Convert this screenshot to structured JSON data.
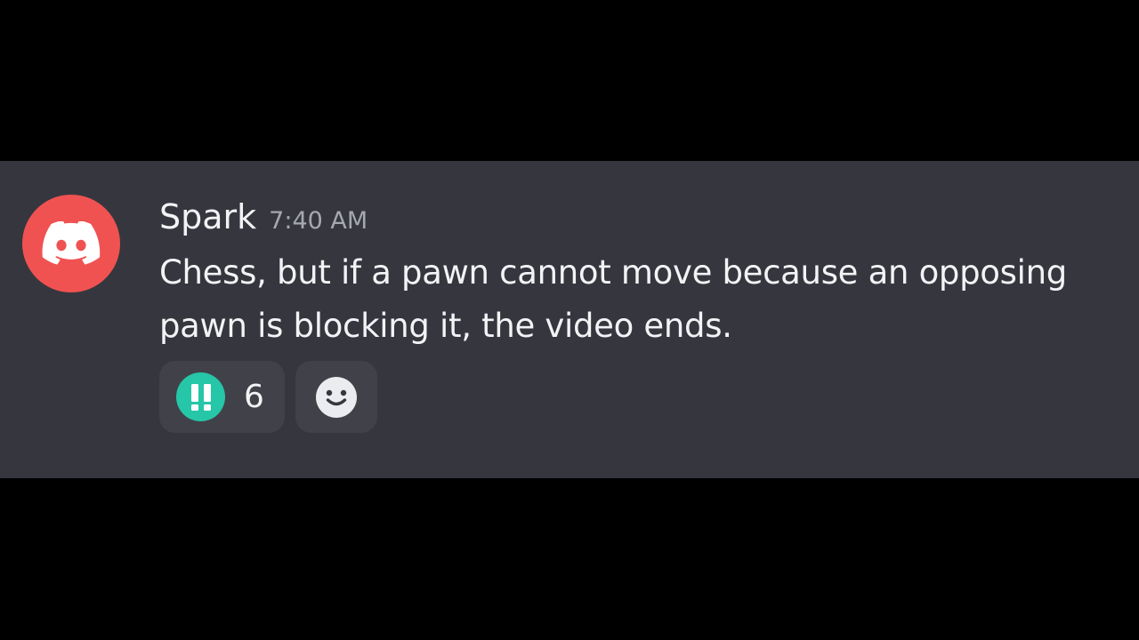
{
  "message": {
    "avatar_icon": "discord-logo-icon",
    "avatar_color": "#f05252",
    "username": "Spark",
    "timestamp": "7:40 AM",
    "content": "Chess, but if a pawn cannot move because an opposing pawn is blocking it, the video ends."
  },
  "reactions": [
    {
      "emoji": "double-exclamation-icon",
      "emoji_color": "#26c6a8",
      "count": "6"
    },
    {
      "emoji": "add-reaction-smiley-icon"
    }
  ],
  "colors": {
    "background": "#000000",
    "message_bg": "#36373e",
    "reaction_bg": "#414249",
    "text": "#f2f3f5",
    "muted": "#a6a8b0"
  }
}
